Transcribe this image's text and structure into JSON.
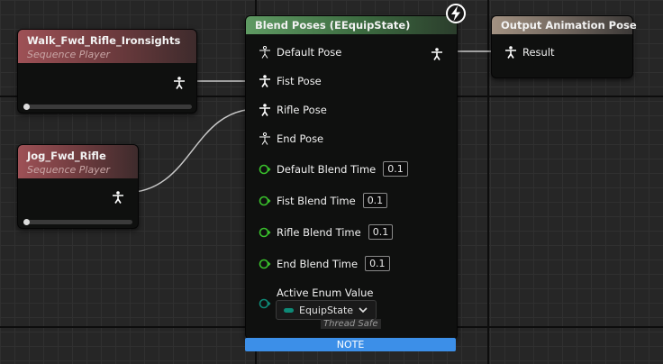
{
  "nodes": {
    "walk": {
      "title": "Walk_Fwd_Rifle_Ironsights",
      "subtitle": "Sequence Player"
    },
    "jog": {
      "title": "Jog_Fwd_Rifle",
      "subtitle": "Sequence Player"
    },
    "blend": {
      "title": "Blend Poses (EEquipState)",
      "pose_pins": [
        "Default Pose",
        "Fist Pose",
        "Rifle Pose",
        "End Pose"
      ],
      "blend_times": [
        {
          "label": "Default Blend Time",
          "value": "0.1"
        },
        {
          "label": "Fist Blend Time",
          "value": "0.1"
        },
        {
          "label": "Rifle Blend Time",
          "value": "0.1"
        },
        {
          "label": "End Blend Time",
          "value": "0.1"
        }
      ],
      "active_enum_label": "Active Enum Value",
      "enum_value": "EquipState",
      "thread_safe": "Thread Safe",
      "note": "NOTE"
    },
    "output": {
      "title": "Output Animation Pose",
      "result": "Result"
    }
  },
  "colors": {
    "pose_pin": "#ffffff",
    "float_pin": "#39c12c",
    "enum_pin": "#0e8a77",
    "note": "#3c8fe8",
    "wire": "#c8c8c8"
  },
  "icons": {
    "pose": "person-pose-icon",
    "float": "float-pin-icon",
    "fast_path": "lightning-icon",
    "dropdown": "chevron-down-icon"
  }
}
